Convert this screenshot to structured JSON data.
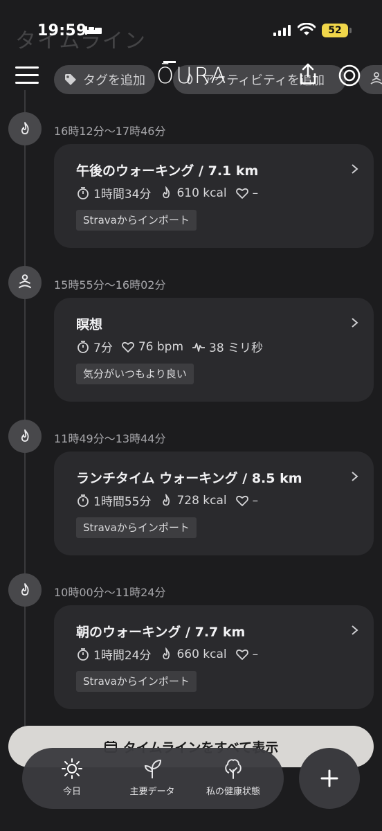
{
  "status_bar": {
    "time": "19:59",
    "battery": "52"
  },
  "page": {
    "ghost_title": "タイムライン"
  },
  "header": {
    "logo": "ŌURA",
    "chips": [
      {
        "label": "タグを追加",
        "icon": "tag-icon"
      },
      {
        "label": "アクティビティを追加",
        "icon": "activity-icon"
      },
      {
        "label": "",
        "icon": "meditation-icon"
      }
    ]
  },
  "timeline": [
    {
      "time_range": "16時12分〜17時46分",
      "icon": "flame-icon",
      "title": "午後のウォーキング / 7.1 km",
      "duration": "1時間34分",
      "calories": "610 kcal",
      "heart": "–",
      "badge": "Stravaからインポート"
    },
    {
      "time_range": "15時55分〜16時02分",
      "icon": "meditation-icon",
      "title": "瞑想",
      "duration": "7分",
      "heart": "76 bpm",
      "hrv": "38 ミリ秒",
      "badge": "気分がいつもより良い"
    },
    {
      "time_range": "11時49分〜13時44分",
      "icon": "flame-icon",
      "title": "ランチタイム ウォーキング / 8.5 km",
      "duration": "1時間55分",
      "calories": "728 kcal",
      "heart": "–",
      "badge": "Stravaからインポート"
    },
    {
      "time_range": "10時00分〜11時24分",
      "icon": "flame-icon",
      "title": "朝のウォーキング / 7.7 km",
      "duration": "1時間24分",
      "calories": "660 kcal",
      "heart": "–",
      "badge": "Stravaからインポート"
    }
  ],
  "show_all_label": "タイムラインをすべて表示",
  "tabbar": {
    "today": "今日",
    "metrics": "主要データ",
    "health": "私の健康状態"
  },
  "colors": {
    "background": "#1c1c1e",
    "card": "#2a2a2d",
    "battery": "#f0d64a"
  }
}
